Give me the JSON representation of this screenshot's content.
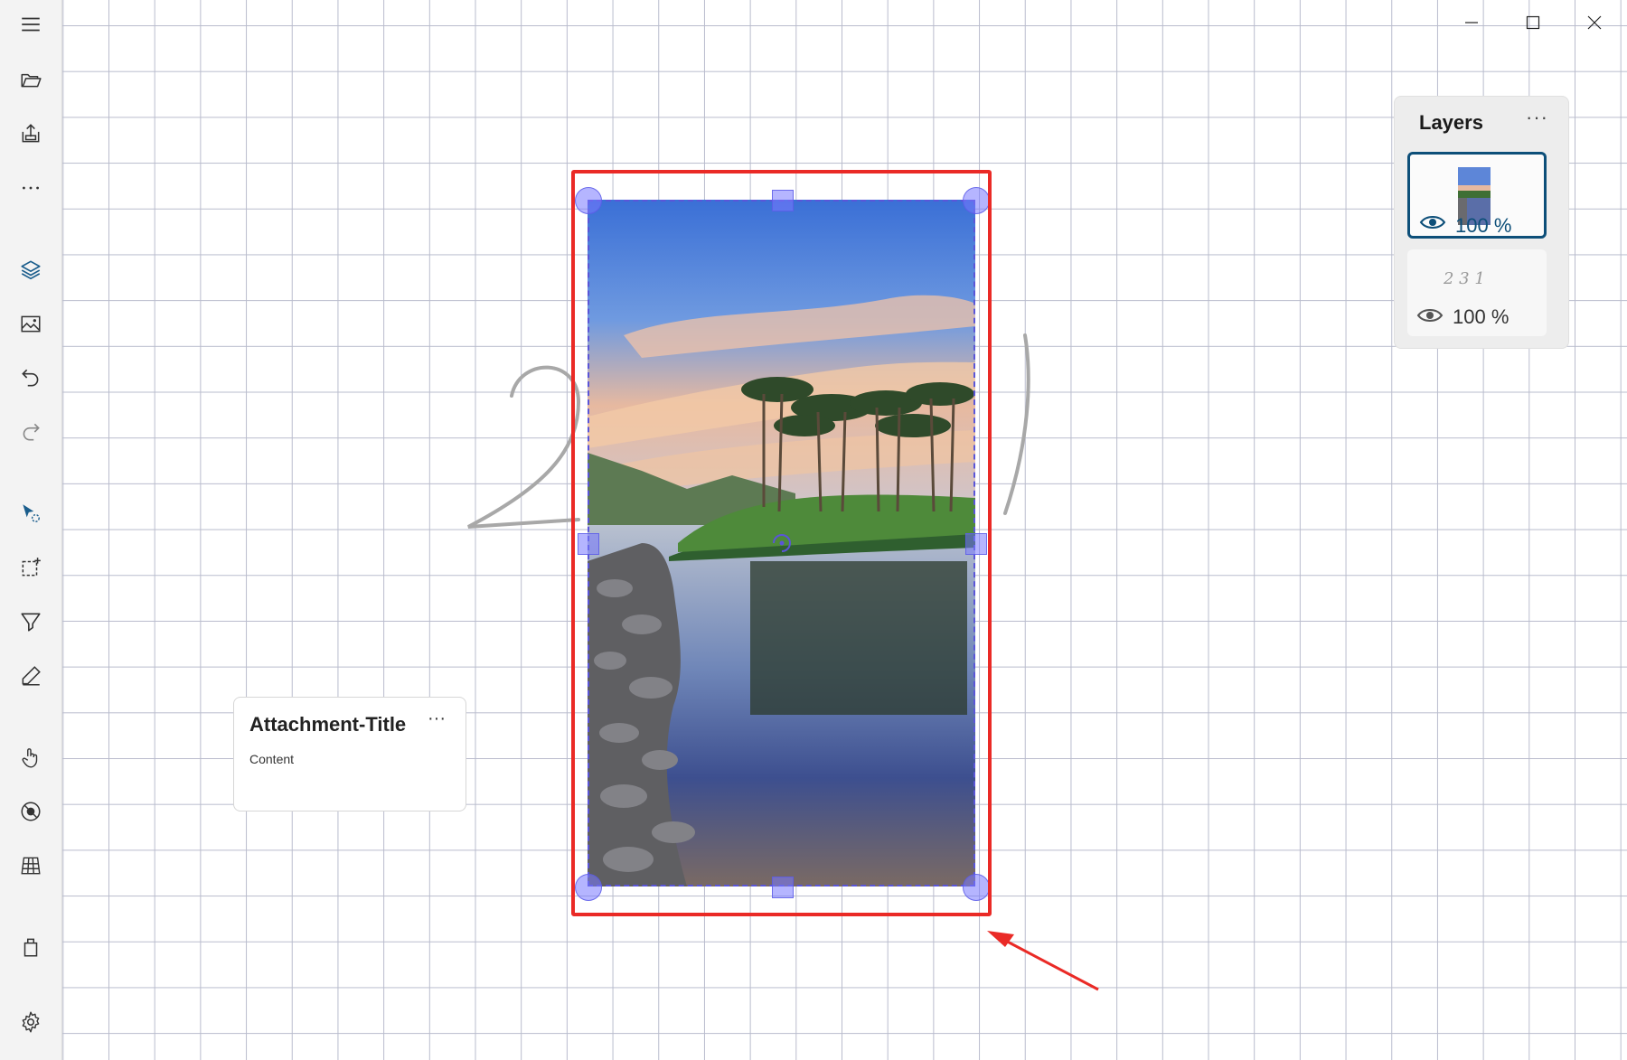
{
  "window": {
    "minimize_icon": "minimize-icon",
    "maximize_icon": "maximize-icon",
    "close_icon": "close-icon"
  },
  "toolbar": {
    "items": [
      {
        "name": "menu",
        "icon": "hamburger-icon"
      },
      {
        "name": "open",
        "icon": "folder-open-icon"
      },
      {
        "name": "export",
        "icon": "export-icon"
      },
      {
        "name": "more",
        "icon": "more-dots-icon"
      },
      {
        "name": "layers",
        "icon": "layers-icon",
        "active": true
      },
      {
        "name": "insert-image",
        "icon": "image-icon"
      },
      {
        "name": "undo",
        "icon": "undo-icon"
      },
      {
        "name": "redo",
        "icon": "redo-icon"
      },
      {
        "name": "select",
        "icon": "select-cursor-icon",
        "active": true
      },
      {
        "name": "lasso",
        "icon": "lasso-select-icon"
      },
      {
        "name": "highlighter",
        "icon": "highlighter-icon"
      },
      {
        "name": "pen",
        "icon": "pen-icon"
      },
      {
        "name": "touch",
        "icon": "touch-hand-icon"
      },
      {
        "name": "disable-touch",
        "icon": "no-touch-icon"
      },
      {
        "name": "grid",
        "icon": "grid-perspective-icon"
      },
      {
        "name": "clear",
        "icon": "trash-bag-icon"
      },
      {
        "name": "settings",
        "icon": "gear-icon"
      }
    ]
  },
  "attachment": {
    "title": "Attachment-Title",
    "more": "···",
    "content": "Content"
  },
  "layers_panel": {
    "title": "Layers",
    "more": "···",
    "layers": [
      {
        "thumbnail": "landscape-photo",
        "opacity": "100 %",
        "visible": true,
        "selected": true
      },
      {
        "thumbnail": "2 3 1",
        "opacity": "100 %",
        "visible": true,
        "selected": false
      }
    ]
  },
  "colors": {
    "selection_box": "#ea2a26",
    "handle": "#7878ff",
    "layer_selected": "#0d4f79",
    "grid": "#b9bccd"
  }
}
